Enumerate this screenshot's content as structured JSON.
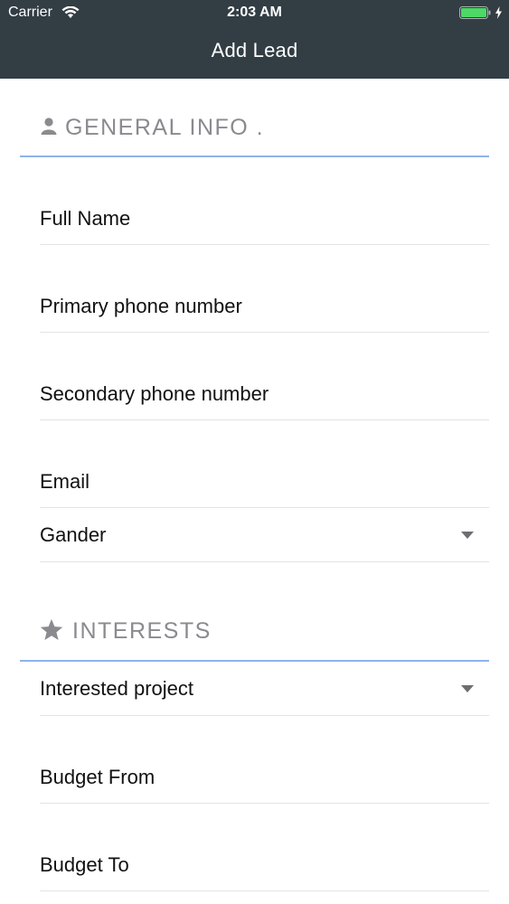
{
  "status_bar": {
    "carrier": "Carrier",
    "time": "2:03 AM"
  },
  "nav": {
    "title": "Add Lead"
  },
  "sections": {
    "general": {
      "label": "GENERAL INFO .",
      "icon": "person-icon"
    },
    "interests": {
      "label": "INTERESTS",
      "icon": "star-icon"
    }
  },
  "fields": {
    "full_name": "Full Name",
    "primary_phone": "Primary phone number",
    "secondary_phone": "Secondary phone number",
    "email": "Email",
    "gender": "Gander",
    "interested_project": "Interested project",
    "budget_from": "Budget From",
    "budget_to": "Budget To"
  },
  "colors": {
    "header_bg": "#323d44",
    "section_underline": "#8fb3ec",
    "section_text": "#8a8a8f",
    "battery": "#4cd964"
  }
}
